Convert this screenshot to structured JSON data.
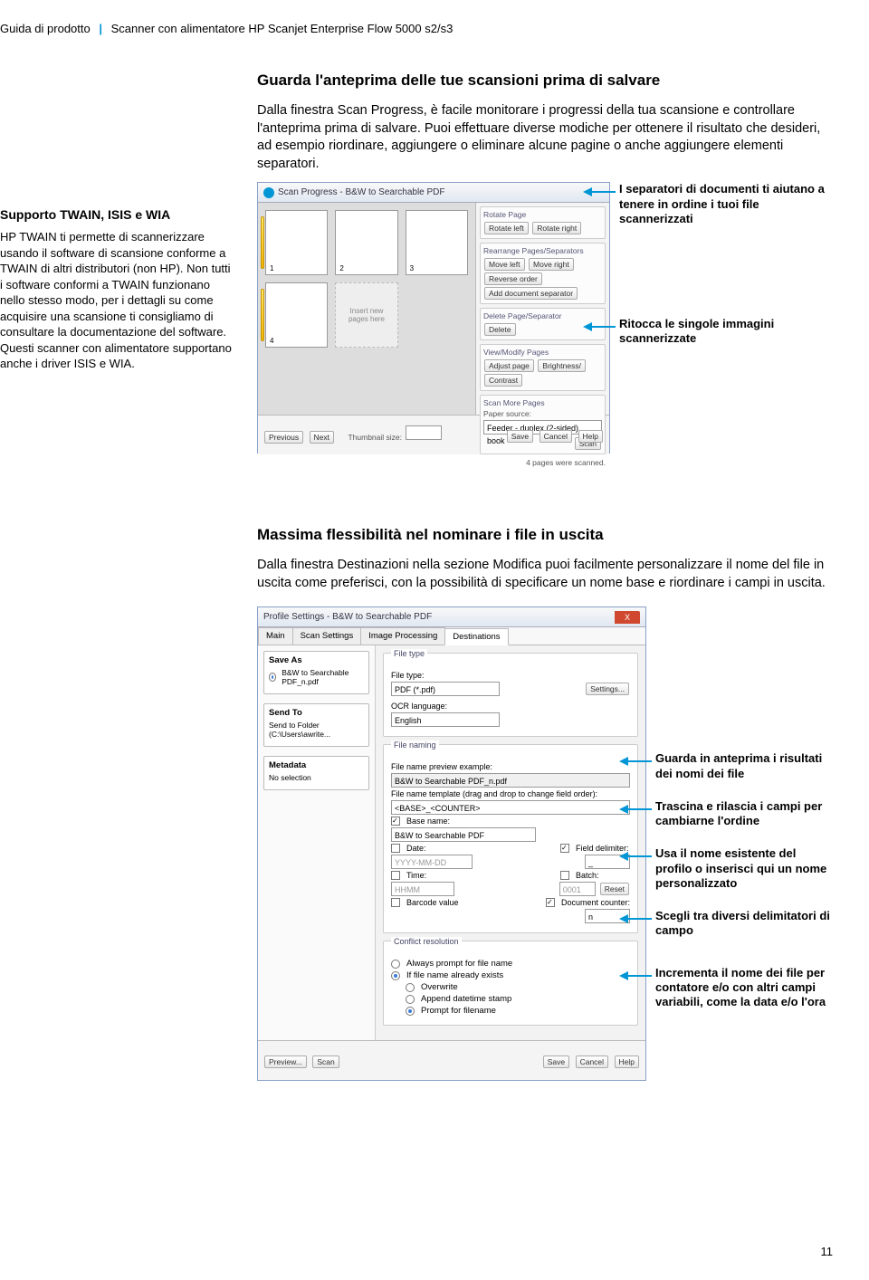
{
  "header": {
    "guide": "Guida di prodotto",
    "product": "Scanner con alimentatore HP Scanjet Enterprise Flow 5000 s2/s3"
  },
  "sidebar": {
    "title": "Supporto TWAIN, ISIS e WIA",
    "body": "HP TWAIN ti permette di scannerizzare usando il software di scansione conforme a TWAIN di altri distributori (non HP). Non tutti i software conformi a TWAIN funzionano nello stesso modo, per i dettagli su come acquisire una scansione ti consigliamo di consultare la documentazione del software. Questi scanner con alimentatore supportano anche i driver ISIS e WIA."
  },
  "section1": {
    "heading": "Guarda l'anteprima delle tue scansioni prima di salvare",
    "intro": "Dalla finestra Scan Progress, è facile monitorare i progressi della tua scansione e controllare l'anteprima prima di salvare. Puoi effettuare diverse modiche per ottenere il risultato che desideri, ad esempio riordinare, aggiungere o eliminare alcune pagine o anche aggiungere elementi separatori.",
    "callout_a": "I separatori di documenti ti aiutano a tenere in ordine i tuoi file scannerizzati",
    "callout_b": "Ritocca le singole immagini scannerizzate",
    "shot": {
      "title": "Scan Progress - B&W to Searchable PDF",
      "thumb_insert": "Insert new pages here",
      "groups": {
        "rotate": "Rotate Page",
        "rotate_l": "Rotate left",
        "rotate_r": "Rotate right",
        "rearr": "Rearrange Pages/Separators",
        "move_l": "Move left",
        "move_r": "Move right",
        "rev": "Reverse order",
        "addsep": "Add document separator",
        "del": "Delete Page/Separator",
        "delete_btn": "Delete",
        "view": "View/Modify Pages",
        "adjust": "Adjust page",
        "bright": "Brightness/",
        "contrast": "Contrast",
        "scanmore": "Scan More Pages",
        "psource": "Paper source:",
        "psource_val": "Feeder - duplex (2-sided), book",
        "scan": "Scan"
      },
      "status": "4 pages were scanned.",
      "footer": {
        "prev": "Previous",
        "next": "Next",
        "thumb": "Thumbnail size:",
        "save": "Save",
        "cancel": "Cancel",
        "help": "Help"
      }
    }
  },
  "section2": {
    "heading": "Massima flessibilità nel nominare i file in uscita",
    "intro": "Dalla finestra Destinazioni nella sezione Modifica puoi facilmente personalizzare il nome del file in uscita come preferisci, con la possibilità di specificare un nome base e riordinare i campi in uscita.",
    "callouts": {
      "a": "Guarda in anteprima i risultati dei nomi dei file",
      "b": "Trascina e rilascia i campi per cambiarne l'ordine",
      "c": "Usa il nome esistente del profilo o inserisci qui un nome personalizzato",
      "d": "Scegli tra diversi delimitatori di campo",
      "e": "Incrementa il nome dei file per contatore e/o con altri campi variabili, come la data e/o l'ora"
    },
    "shot": {
      "title": "Profile Settings - B&W to Searchable PDF",
      "tabs": [
        "Main",
        "Scan Settings",
        "Image Processing",
        "Destinations"
      ],
      "saveas": {
        "title": "Save As",
        "val": "B&W to Searchable PDF_n.pdf"
      },
      "sendto": {
        "title": "Send To",
        "val": "Send to Folder (C:\\Users\\awrite..."
      },
      "metadata": {
        "title": "Metadata",
        "val": "No selection"
      },
      "filetype": {
        "group": "File type",
        "label": "File type:",
        "val": "PDF (*.pdf)",
        "settings": "Settings...",
        "ocr_label": "OCR language:",
        "ocr_val": "English"
      },
      "naming": {
        "group": "File naming",
        "preview_label": "File name preview example:",
        "preview_val": "B&W to Searchable PDF_n.pdf",
        "template_label": "File name template (drag and drop to change field order):",
        "template_val": "<BASE>_<COUNTER>",
        "base_label": "Base name:",
        "base_val": "B&W to Searchable PDF",
        "date_label": "Date:",
        "date_val": "YYYY-MM-DD",
        "delim_label": "Field delimiter:",
        "delim_val": "_",
        "time_label": "Time:",
        "time_val": "HHMM",
        "batch_label": "Batch:",
        "batch_val": "0001",
        "reset": "Reset",
        "barcode_label": "Barcode value",
        "counter_label": "Document counter:",
        "counter_val": "n"
      },
      "conflict": {
        "group": "Conflict resolution",
        "o1": "Always prompt for file name",
        "o2": "If file name already exists",
        "o2a": "Overwrite",
        "o2b": "Append datetime stamp",
        "o2c": "Prompt for filename"
      },
      "footer": {
        "preview": "Preview...",
        "scan": "Scan",
        "save": "Save",
        "cancel": "Cancel",
        "help": "Help"
      }
    }
  },
  "pagenum": "11"
}
